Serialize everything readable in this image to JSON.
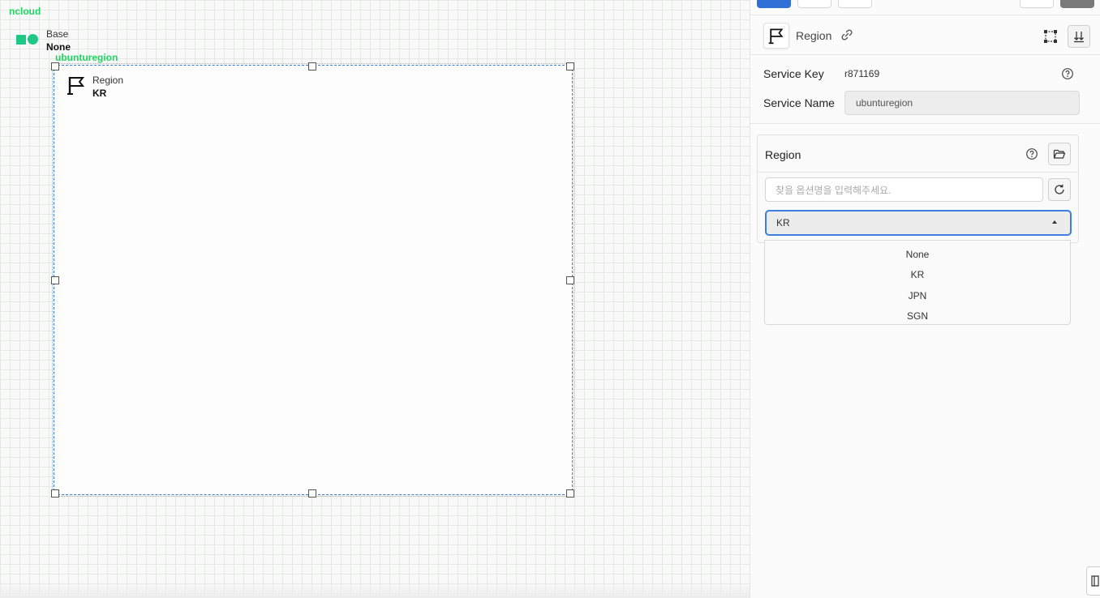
{
  "canvas": {
    "name": "ncloud",
    "base_node": {
      "label": "Base",
      "value": "None"
    },
    "region_node": {
      "name": "ubunturegion",
      "label": "Region",
      "value": "KR"
    }
  },
  "panel": {
    "header": {
      "title": "Region",
      "icon": "flag-icon"
    },
    "service_key": {
      "label": "Service Key",
      "value": "r871169"
    },
    "service_name": {
      "label": "Service Name",
      "value": "ubunturegion"
    },
    "region_section": {
      "title": "Region",
      "search_placeholder": "찾을 옵션명을 입력해주세요.",
      "selected": "KR",
      "options": [
        "None",
        "KR",
        "JPN",
        "SGN"
      ]
    }
  },
  "colors": {
    "accent": "#3d7fe0",
    "tag_green": "#1ed760",
    "base_icon": "#1fc787"
  }
}
